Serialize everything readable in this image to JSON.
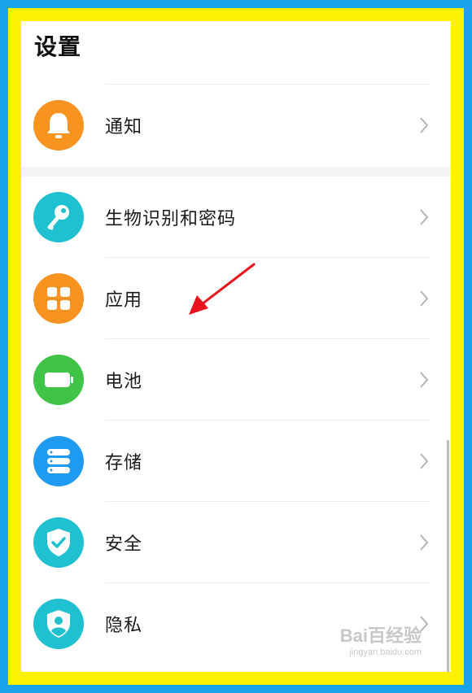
{
  "header": {
    "title": "设置"
  },
  "settings": {
    "notification": {
      "label": "通知",
      "icon": "bell-icon",
      "color": "#f7931e"
    },
    "biometrics": {
      "label": "生物识别和密码",
      "icon": "key-icon",
      "color": "#1fc0d0"
    },
    "apps": {
      "label": "应用",
      "icon": "grid-icon",
      "color": "#f7931e"
    },
    "battery": {
      "label": "电池",
      "icon": "battery-icon",
      "color": "#3fc447"
    },
    "storage": {
      "label": "存储",
      "icon": "storage-icon",
      "color": "#1e9af0"
    },
    "security": {
      "label": "安全",
      "icon": "shield-check-icon",
      "color": "#1fc0d0"
    },
    "privacy": {
      "label": "隐私",
      "icon": "privacy-icon",
      "color": "#1fc0d0"
    }
  },
  "colors": {
    "outer_border": "#1aa3e8",
    "inner_border": "#fff200",
    "annotation_arrow": "#e8141c"
  },
  "watermark": {
    "main": "Bai百经验",
    "sub": "jingyan.baidu.com"
  }
}
